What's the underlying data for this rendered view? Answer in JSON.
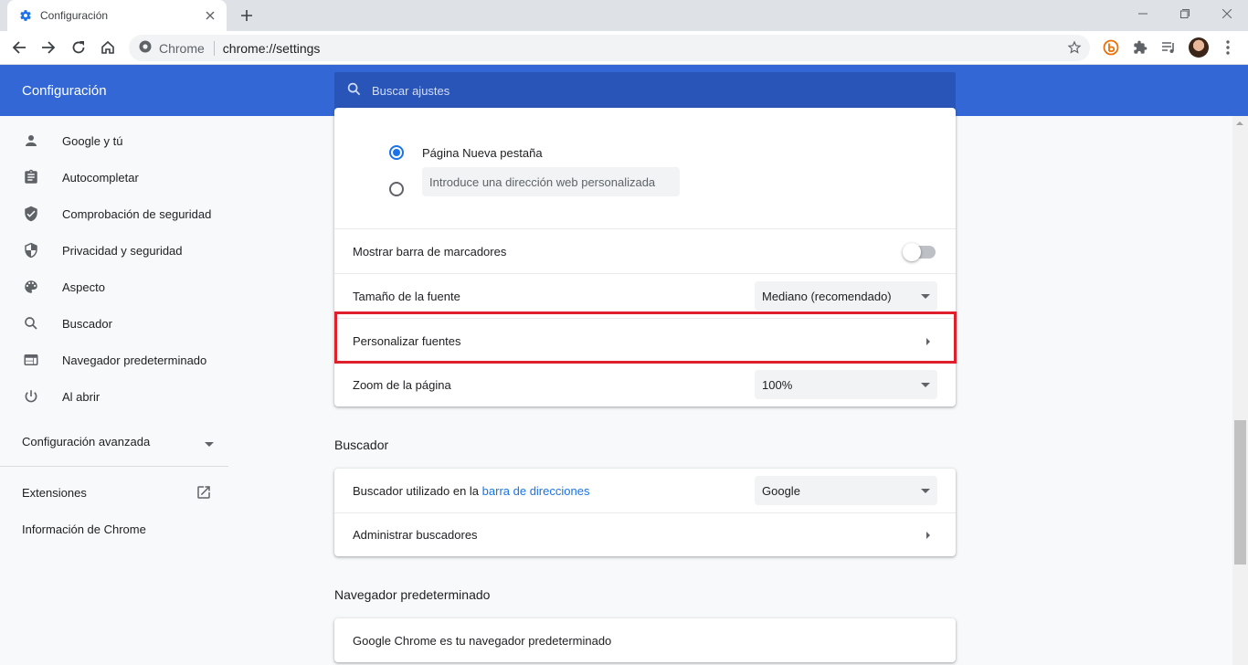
{
  "tab": {
    "title": "Configuración",
    "favicon": "gear-icon"
  },
  "address_bar": {
    "origin": "Chrome",
    "url": "chrome://settings"
  },
  "header": {
    "title": "Configuración",
    "search_placeholder": "Buscar ajustes"
  },
  "sidebar": {
    "items": [
      {
        "label": "Google y tú",
        "icon": "person-icon"
      },
      {
        "label": "Autocompletar",
        "icon": "clipboard-icon"
      },
      {
        "label": "Comprobación de seguridad",
        "icon": "shield-check-icon"
      },
      {
        "label": "Privacidad y seguridad",
        "icon": "shield-icon"
      },
      {
        "label": "Aspecto",
        "icon": "palette-icon"
      },
      {
        "label": "Buscador",
        "icon": "search-icon"
      },
      {
        "label": "Navegador predeterminado",
        "icon": "browser-window-icon"
      },
      {
        "label": "Al abrir",
        "icon": "power-icon"
      }
    ],
    "advanced": "Configuración avanzada",
    "extensions": "Extensiones",
    "about": "Información de Chrome"
  },
  "appearance": {
    "radio_new_tab": "Página Nueva pestaña",
    "radio_custom_placeholder": "Introduce una dirección web personalizada",
    "bookmarks_bar": "Mostrar barra de marcadores",
    "bookmarks_bar_enabled": false,
    "font_size_label": "Tamaño de la fuente",
    "font_size_value": "Mediano (recomendado)",
    "customize_fonts": "Personalizar fuentes",
    "zoom_label": "Zoom de la página",
    "zoom_value": "100%"
  },
  "search_engine": {
    "section_title": "Buscador",
    "engine_label_prefix": "Buscador utilizado en la ",
    "engine_label_link": "barra de direcciones",
    "engine_value": "Google",
    "manage": "Administrar buscadores"
  },
  "default_browser": {
    "section_title": "Navegador predeterminado",
    "status": "Google Chrome es tu navegador predeterminado"
  },
  "colors": {
    "header": "#3367d6",
    "search_box": "#2a55b8",
    "accent": "#1a73e8",
    "highlight": "#e01f2c"
  }
}
